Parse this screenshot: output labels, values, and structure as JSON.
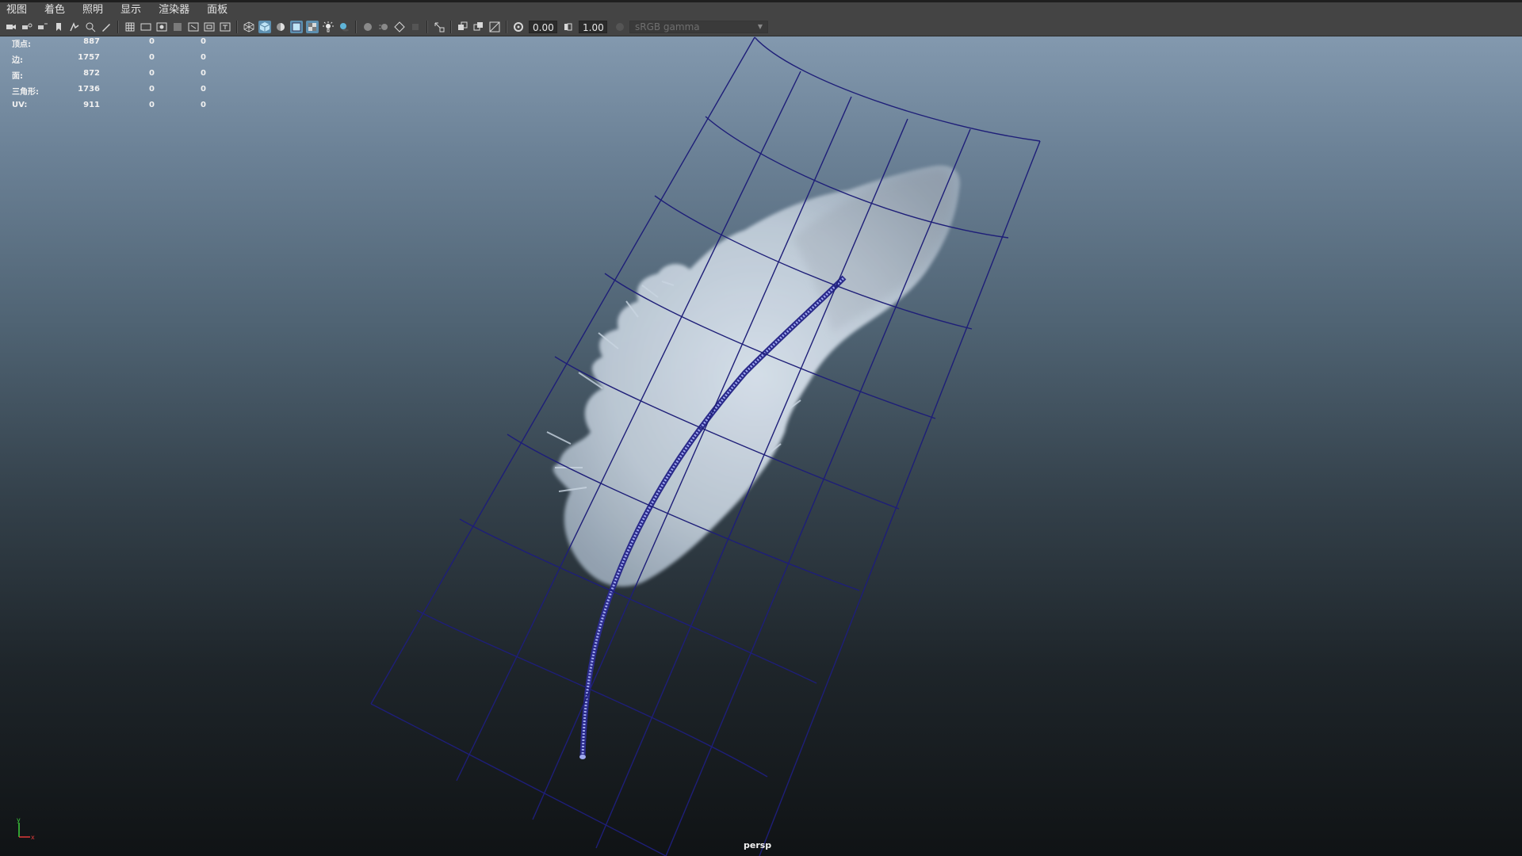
{
  "menu": [
    "视图",
    "着色",
    "照明",
    "显示",
    "渲染器",
    "面板"
  ],
  "toolbar": {
    "exposure_value": "0.00",
    "gamma_value": "1.00",
    "colorspace": "sRGB gamma",
    "icons": [
      "camera-select-icon",
      "camera-attributes-icon",
      "bookmark-icon",
      "image-plane-icon",
      "grid-icon",
      "film-gate-icon",
      "resolution-gate-icon",
      "wireframe-icon",
      "smooth-shade-icon",
      "textured-icon",
      "lights-icon",
      "shadows-icon",
      "xray-icon",
      "isolate-select-icon",
      "exposure-icon",
      "gamma-icon"
    ]
  },
  "hud": {
    "rows": [
      {
        "label": "顶点:",
        "v1": "887",
        "v2": "0",
        "v3": "0"
      },
      {
        "label": "边:",
        "v1": "1757",
        "v2": "0",
        "v3": "0"
      },
      {
        "label": "面:",
        "v1": "872",
        "v2": "0",
        "v3": "0"
      },
      {
        "label": "三角形:",
        "v1": "1736",
        "v2": "0",
        "v3": "0"
      },
      {
        "label": "UV:",
        "v1": "911",
        "v2": "0",
        "v3": "0"
      }
    ]
  },
  "camera_label": "persp",
  "axis": {
    "y_label": "y",
    "x_label": "x"
  },
  "colors": {
    "toolbar_bg": "#444444",
    "wireframe": "#1e1e78",
    "active_icon": "#5d8fb0",
    "axis_y": "#3ccf3c",
    "axis_x": "#e03a3a"
  }
}
